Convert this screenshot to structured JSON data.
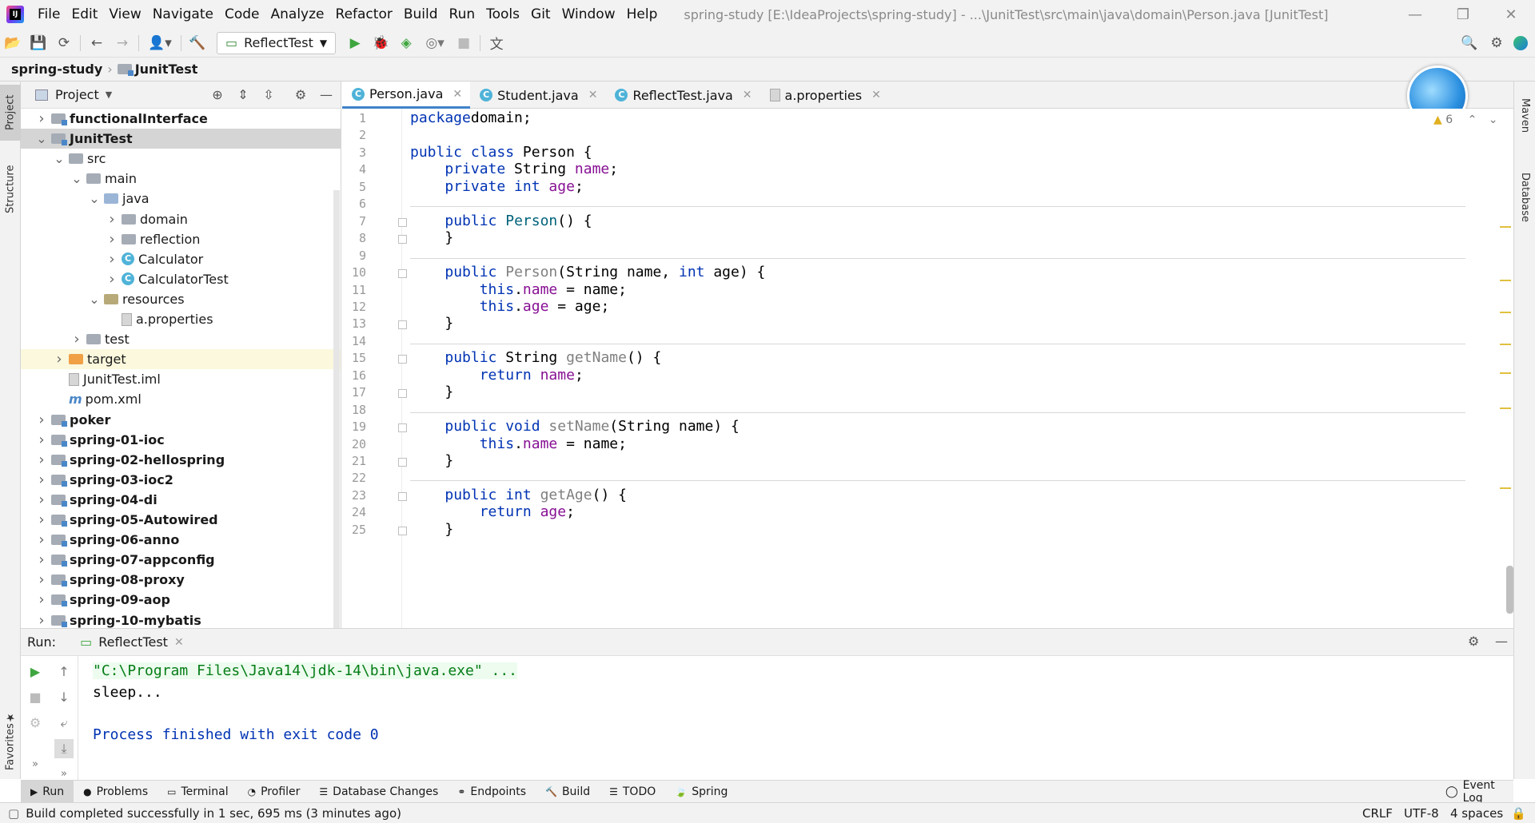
{
  "menu": {
    "items": [
      "File",
      "Edit",
      "View",
      "Navigate",
      "Code",
      "Analyze",
      "Refactor",
      "Build",
      "Run",
      "Tools",
      "Git",
      "Window",
      "Help"
    ],
    "title": "spring-study [E:\\IdeaProjects\\spring-study] - ...\\JunitTest\\src\\main\\java\\domain\\Person.java [JunitTest]"
  },
  "toolbar": {
    "run_config": "ReflectTest"
  },
  "navbar": {
    "project": "spring-study",
    "module": "JunitTest"
  },
  "side": {
    "project_tab": "Project",
    "structure_tab": "Structure",
    "favorites_tab": "Favorites",
    "maven_tab": "Maven",
    "database_tab": "Database"
  },
  "project": {
    "header": "Project",
    "tree": [
      {
        "label": "functionalInterface",
        "depth": 0,
        "arrow": "›",
        "icon": "mod",
        "bold": true
      },
      {
        "label": "JunitTest",
        "depth": 0,
        "arrow": "⌄",
        "icon": "mod",
        "bold": true
      },
      {
        "label": "src",
        "depth": 1,
        "arrow": "⌄",
        "icon": "folder",
        "bold": false
      },
      {
        "label": "main",
        "depth": 2,
        "arrow": "⌄",
        "icon": "folder",
        "bold": false
      },
      {
        "label": "java",
        "depth": 3,
        "arrow": "⌄",
        "icon": "src",
        "bold": false
      },
      {
        "label": "domain",
        "depth": 4,
        "arrow": "›",
        "icon": "folder",
        "bold": false
      },
      {
        "label": "reflection",
        "depth": 4,
        "arrow": "›",
        "icon": "folder",
        "bold": false
      },
      {
        "label": "Calculator",
        "depth": 4,
        "arrow": "›",
        "icon": "class",
        "bold": false
      },
      {
        "label": "CalculatorTest",
        "depth": 4,
        "arrow": "›",
        "icon": "class",
        "bold": false
      },
      {
        "label": "resources",
        "depth": 3,
        "arrow": "⌄",
        "icon": "res",
        "bold": false
      },
      {
        "label": "a.properties",
        "depth": 4,
        "arrow": "",
        "icon": "file",
        "bold": false
      },
      {
        "label": "test",
        "depth": 2,
        "arrow": "›",
        "icon": "folder",
        "bold": false
      },
      {
        "label": "target",
        "depth": 1,
        "arrow": "›",
        "icon": "orange",
        "bold": false
      },
      {
        "label": "JunitTest.iml",
        "depth": 1,
        "arrow": "",
        "icon": "file",
        "bold": false
      },
      {
        "label": "pom.xml",
        "depth": 1,
        "arrow": "",
        "icon": "maven",
        "bold": false
      },
      {
        "label": "poker",
        "depth": 0,
        "arrow": "›",
        "icon": "mod",
        "bold": true
      },
      {
        "label": "spring-01-ioc",
        "depth": 0,
        "arrow": "›",
        "icon": "mod",
        "bold": true
      },
      {
        "label": "spring-02-hellospring",
        "depth": 0,
        "arrow": "›",
        "icon": "mod",
        "bold": true
      },
      {
        "label": "spring-03-ioc2",
        "depth": 0,
        "arrow": "›",
        "icon": "mod",
        "bold": true
      },
      {
        "label": "spring-04-di",
        "depth": 0,
        "arrow": "›",
        "icon": "mod",
        "bold": true
      },
      {
        "label": "spring-05-Autowired",
        "depth": 0,
        "arrow": "›",
        "icon": "mod",
        "bold": true
      },
      {
        "label": "spring-06-anno",
        "depth": 0,
        "arrow": "›",
        "icon": "mod",
        "bold": true
      },
      {
        "label": "spring-07-appconfig",
        "depth": 0,
        "arrow": "›",
        "icon": "mod",
        "bold": true
      },
      {
        "label": "spring-08-proxy",
        "depth": 0,
        "arrow": "›",
        "icon": "mod",
        "bold": true
      },
      {
        "label": "spring-09-aop",
        "depth": 0,
        "arrow": "›",
        "icon": "mod",
        "bold": true
      },
      {
        "label": "spring-10-mybatis",
        "depth": 0,
        "arrow": "›",
        "icon": "mod",
        "bold": true
      }
    ]
  },
  "tabs": [
    {
      "label": "Person.java",
      "icon": "C",
      "active": true
    },
    {
      "label": "Student.java",
      "icon": "C",
      "active": false
    },
    {
      "label": "ReflectTest.java",
      "icon": "C",
      "active": false
    },
    {
      "label": "a.properties",
      "icon": "file",
      "active": false
    }
  ],
  "editor": {
    "warning_count": "6",
    "lines": [
      [
        [
          "kw",
          "package"
        ],
        [
          "",
          "domain;"
        ]
      ],
      [],
      [
        [
          "kw",
          "public class"
        ],
        [
          "",
          " Person {"
        ]
      ],
      [
        [
          "",
          "    "
        ],
        [
          "kw",
          "private"
        ],
        [
          "",
          " String "
        ],
        [
          "fld",
          "name"
        ],
        [
          "",
          ";"
        ]
      ],
      [
        [
          "",
          "    "
        ],
        [
          "kw",
          "private int"
        ],
        [
          "",
          " "
        ],
        [
          "fld",
          "age"
        ],
        [
          "",
          ";"
        ]
      ],
      [],
      [
        [
          "",
          "    "
        ],
        [
          "kw",
          "public"
        ],
        [
          "",
          " "
        ],
        [
          "mth",
          "Person"
        ],
        [
          "",
          "() {"
        ]
      ],
      [
        [
          "",
          "    }"
        ]
      ],
      [],
      [
        [
          "",
          "    "
        ],
        [
          "kw",
          "public"
        ],
        [
          "",
          " "
        ],
        [
          "unused",
          "Person"
        ],
        [
          "",
          "(String name, "
        ],
        [
          "kw",
          "int"
        ],
        [
          "",
          " age) {"
        ]
      ],
      [
        [
          "",
          "        "
        ],
        [
          "kw",
          "this"
        ],
        [
          "",
          "."
        ],
        [
          "fld",
          "name"
        ],
        [
          "",
          " = name;"
        ]
      ],
      [
        [
          "",
          "        "
        ],
        [
          "kw",
          "this"
        ],
        [
          "",
          "."
        ],
        [
          "fld",
          "age"
        ],
        [
          "",
          " = age;"
        ]
      ],
      [
        [
          "",
          "    }"
        ]
      ],
      [],
      [
        [
          "",
          "    "
        ],
        [
          "kw",
          "public"
        ],
        [
          "",
          " String "
        ],
        [
          "unused",
          "getName"
        ],
        [
          "",
          "() {"
        ]
      ],
      [
        [
          "",
          "        "
        ],
        [
          "kw",
          "return"
        ],
        [
          "",
          " "
        ],
        [
          "fld",
          "name"
        ],
        [
          "",
          ";"
        ]
      ],
      [
        [
          "",
          "    }"
        ]
      ],
      [],
      [
        [
          "",
          "    "
        ],
        [
          "kw",
          "public void"
        ],
        [
          "",
          " "
        ],
        [
          "unused",
          "setName"
        ],
        [
          "",
          "(String name) {"
        ]
      ],
      [
        [
          "",
          "        "
        ],
        [
          "kw",
          "this"
        ],
        [
          "",
          "."
        ],
        [
          "fld",
          "name"
        ],
        [
          "",
          " = name;"
        ]
      ],
      [
        [
          "",
          "    }"
        ]
      ],
      [],
      [
        [
          "",
          "    "
        ],
        [
          "kw",
          "public int"
        ],
        [
          "",
          " "
        ],
        [
          "unused",
          "getAge"
        ],
        [
          "",
          "() {"
        ]
      ],
      [
        [
          "",
          "        "
        ],
        [
          "kw",
          "return"
        ],
        [
          "",
          " "
        ],
        [
          "fld",
          "age"
        ],
        [
          "",
          ";"
        ]
      ],
      [
        [
          "",
          "    }"
        ]
      ]
    ]
  },
  "run": {
    "label": "Run:",
    "tab": "ReflectTest",
    "console": [
      {
        "text": "\"C:\\Program Files\\Java14\\jdk-14\\bin\\java.exe\" ...",
        "color": "#067d17",
        "bg": "#edfcef"
      },
      {
        "text": "sleep...",
        "color": "#000000",
        "bg": ""
      },
      {
        "text": "",
        "color": "#000000",
        "bg": ""
      },
      {
        "text": "Process finished with exit code 0",
        "color": "#0033b3",
        "bg": ""
      }
    ]
  },
  "bottom_tabs": [
    "Run",
    "Problems",
    "Terminal",
    "Profiler",
    "Database Changes",
    "Endpoints",
    "Build",
    "TODO",
    "Spring"
  ],
  "event_log": "Event Log",
  "status": {
    "message": "Build completed successfully in 1 sec, 695 ms (3 minutes ago)",
    "line_sep": "CRLF",
    "encoding": "UTF-8",
    "indent": "4 spaces"
  }
}
